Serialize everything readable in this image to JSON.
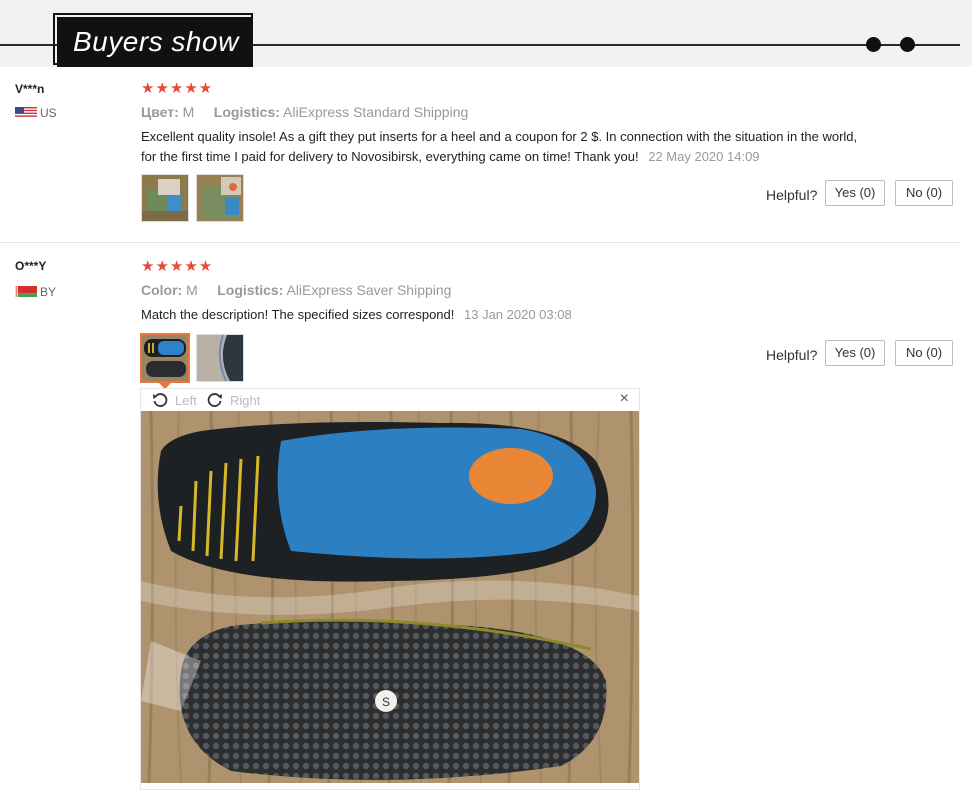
{
  "header": {
    "title": "Buyers show"
  },
  "reviews": [
    {
      "name": "V***n",
      "country": "US",
      "stars": "★★★★★",
      "attr_label_1": "Цвет:",
      "attr_value_1": "M",
      "attr_label_2": "Logistics:",
      "attr_value_2": "AliExpress Standard Shipping",
      "text": "Excellent quality insole! As a gift they put inserts for a heel and a coupon for 2 $. In connection with the situation in the world, for the first time I paid for delivery to Novosibirsk, everything came on time! Thank you!",
      "date": "22 May 2020 14:09",
      "helpful_label": "Helpful?",
      "yes_label": "Yes (0)",
      "no_label": "No (0)"
    },
    {
      "name": "O***Y",
      "country": "BY",
      "stars": "★★★★★",
      "attr_label_1": "Color:",
      "attr_value_1": "M",
      "attr_label_2": "Logistics:",
      "attr_value_2": "AliExpress Saver Shipping",
      "text": "Match the description! The specified sizes correspond!",
      "date": "13 Jan 2020 03:08",
      "helpful_label": "Helpful?",
      "yes_label": "Yes (0)",
      "no_label": "No (0)"
    }
  ],
  "viewer": {
    "left_label": "Left",
    "right_label": "Right",
    "close_glyph": "×",
    "rotate_left_icon": "rotate-left-icon",
    "rotate_right_icon": "rotate-right-icon",
    "size_mark": "S"
  },
  "colors": {
    "star": "#e8493a",
    "active_thumb": "#e7773a",
    "header_bg": "#f2f2f2"
  }
}
